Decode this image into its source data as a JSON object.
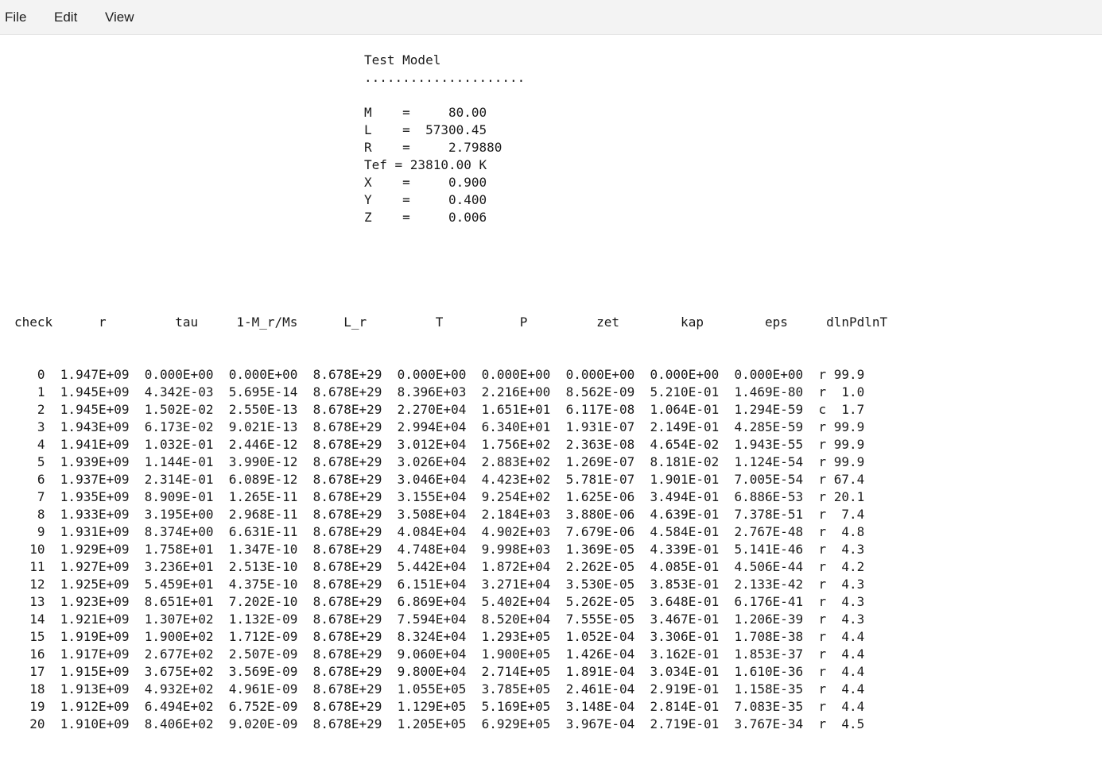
{
  "menu": {
    "file": "File",
    "edit": "Edit",
    "view": "View"
  },
  "document": {
    "header_lines": [
      "Test Model",
      ".....................",
      "",
      "M    =     80.00",
      "L    =  57300.45",
      "R    =     2.79880",
      "Tef = 23810.00 K",
      "X    =     0.900",
      "Y    =     0.400",
      "Z    =     0.006"
    ],
    "table_header": "check      r         tau     1-M_r/Ms      L_r         T          P         zet        kap        eps     dlnPdlnT",
    "table_rows": [
      "   0  1.947E+09  0.000E+00  0.000E+00  8.678E+29  0.000E+00  0.000E+00  0.000E+00  0.000E+00  0.000E+00  r 99.9",
      "   1  1.945E+09  4.342E-03  5.695E-14  8.678E+29  8.396E+03  2.216E+00  8.562E-09  5.210E-01  1.469E-80  r  1.0",
      "   2  1.945E+09  1.502E-02  2.550E-13  8.678E+29  2.270E+04  1.651E+01  6.117E-08  1.064E-01  1.294E-59  c  1.7",
      "   3  1.943E+09  6.173E-02  9.021E-13  8.678E+29  2.994E+04  6.340E+01  1.931E-07  2.149E-01  4.285E-59  r 99.9",
      "   4  1.941E+09  1.032E-01  2.446E-12  8.678E+29  3.012E+04  1.756E+02  2.363E-08  4.654E-02  1.943E-55  r 99.9",
      "   5  1.939E+09  1.144E-01  3.990E-12  8.678E+29  3.026E+04  2.883E+02  1.269E-07  8.181E-02  1.124E-54  r 99.9",
      "   6  1.937E+09  2.314E-01  6.089E-12  8.678E+29  3.046E+04  4.423E+02  5.781E-07  1.901E-01  7.005E-54  r 67.4",
      "   7  1.935E+09  8.909E-01  1.265E-11  8.678E+29  3.155E+04  9.254E+02  1.625E-06  3.494E-01  6.886E-53  r 20.1",
      "   8  1.933E+09  3.195E+00  2.968E-11  8.678E+29  3.508E+04  2.184E+03  3.880E-06  4.639E-01  7.378E-51  r  7.4",
      "   9  1.931E+09  8.374E+00  6.631E-11  8.678E+29  4.084E+04  4.902E+03  7.679E-06  4.584E-01  2.767E-48  r  4.8",
      "  10  1.929E+09  1.758E+01  1.347E-10  8.678E+29  4.748E+04  9.998E+03  1.369E-05  4.339E-01  5.141E-46  r  4.3",
      "  11  1.927E+09  3.236E+01  2.513E-10  8.678E+29  5.442E+04  1.872E+04  2.262E-05  4.085E-01  4.506E-44  r  4.2",
      "  12  1.925E+09  5.459E+01  4.375E-10  8.678E+29  6.151E+04  3.271E+04  3.530E-05  3.853E-01  2.133E-42  r  4.3",
      "  13  1.923E+09  8.651E+01  7.202E-10  8.678E+29  6.869E+04  5.402E+04  5.262E-05  3.648E-01  6.176E-41  r  4.3",
      "  14  1.921E+09  1.307E+02  1.132E-09  8.678E+29  7.594E+04  8.520E+04  7.555E-05  3.467E-01  1.206E-39  r  4.3",
      "  15  1.919E+09  1.900E+02  1.712E-09  8.678E+29  8.324E+04  1.293E+05  1.052E-04  3.306E-01  1.708E-38  r  4.4",
      "  16  1.917E+09  2.677E+02  2.507E-09  8.678E+29  9.060E+04  1.900E+05  1.426E-04  3.162E-01  1.853E-37  r  4.4",
      "  17  1.915E+09  3.675E+02  3.569E-09  8.678E+29  9.800E+04  2.714E+05  1.891E-04  3.034E-01  1.610E-36  r  4.4",
      "  18  1.913E+09  4.932E+02  4.961E-09  8.678E+29  1.055E+05  3.785E+05  2.461E-04  2.919E-01  1.158E-35  r  4.4",
      "  19  1.912E+09  6.494E+02  6.752E-09  8.678E+29  1.129E+05  5.169E+05  3.148E-04  2.814E-01  7.083E-35  r  4.4",
      "  20  1.910E+09  8.406E+02  9.020E-09  8.678E+29  1.205E+05  6.929E+05  3.967E-04  2.719E-01  3.767E-34  r  4.5"
    ]
  }
}
